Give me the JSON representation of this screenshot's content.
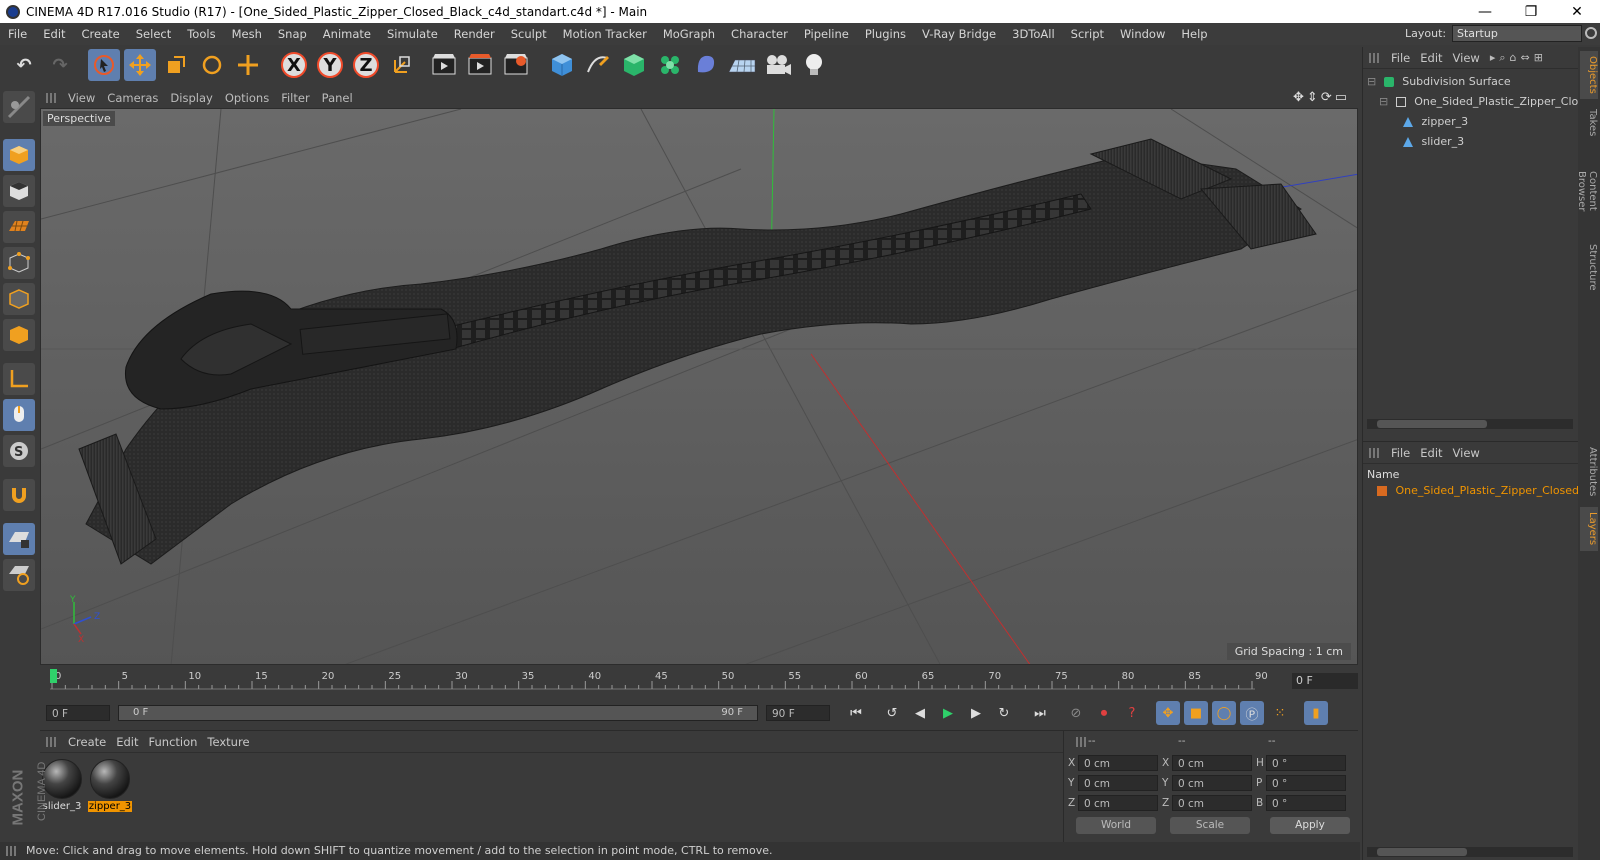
{
  "window": {
    "title": "CINEMA 4D R17.016 Studio (R17) - [One_Sided_Plastic_Zipper_Closed_Black_c4d_standart.c4d *] - Main",
    "minimize": "—",
    "maximize": "❐",
    "close": "✕"
  },
  "menubar": {
    "items": [
      "File",
      "Edit",
      "Create",
      "Select",
      "Tools",
      "Mesh",
      "Snap",
      "Animate",
      "Simulate",
      "Render",
      "Sculpt",
      "Motion Tracker",
      "MoGraph",
      "Character",
      "Pipeline",
      "Plugins",
      "V-Ray Bridge",
      "3DToAll",
      "Script",
      "Window",
      "Help"
    ],
    "layout_label": "Layout:",
    "layout_value": "Startup"
  },
  "toolbar": {
    "icons": [
      "undo-icon",
      "redo-icon",
      "live-selection-icon",
      "move-icon",
      "scale-icon",
      "rotate-icon",
      "last-tool-icon",
      "x-axis-icon",
      "y-axis-icon",
      "z-axis-icon",
      "coordinate-system-icon",
      "render-view-icon",
      "render-picture-viewer-icon",
      "edit-render-settings-icon",
      "cube-icon",
      "pen-spline-icon",
      "subdivision-icon",
      "cloner-icon",
      "deformer-icon",
      "floor-icon",
      "camera-icon",
      "light-icon"
    ],
    "x_label": "X",
    "y_label": "Y",
    "z_label": "Z"
  },
  "viewport": {
    "menu": [
      "View",
      "Cameras",
      "Display",
      "Options",
      "Filter",
      "Panel"
    ],
    "camera_label": "Perspective",
    "grid_spacing": "Grid Spacing : 1 cm",
    "axis_labels": {
      "y": "Y",
      "z": "Z",
      "x": "X"
    }
  },
  "timeline": {
    "ticks": [
      "0",
      "5",
      "10",
      "15",
      "20",
      "25",
      "30",
      "35",
      "40",
      "45",
      "50",
      "55",
      "60",
      "65",
      "70",
      "75",
      "80",
      "85",
      "90"
    ],
    "current_frame": "0 F",
    "start_field": "0 F",
    "range_start": "0 F",
    "range_end": "90 F",
    "end_field": "90 F"
  },
  "material_panel": {
    "menu": [
      "Create",
      "Edit",
      "Function",
      "Texture"
    ],
    "materials": [
      {
        "name": "slider_3",
        "selected": false
      },
      {
        "name": "zipper_3",
        "selected": true
      }
    ]
  },
  "coords": {
    "headers": [
      "--",
      "--",
      "--"
    ],
    "rows": [
      {
        "a": "X",
        "av": "0 cm",
        "b": "X",
        "bv": "0 cm",
        "c": "H",
        "cv": "0 °"
      },
      {
        "a": "Y",
        "av": "0 cm",
        "b": "Y",
        "bv": "0 cm",
        "c": "P",
        "cv": "0 °"
      },
      {
        "a": "Z",
        "av": "0 cm",
        "b": "Z",
        "bv": "0 cm",
        "c": "B",
        "cv": "0 °"
      }
    ],
    "world": "World",
    "scale": "Scale",
    "apply": "Apply"
  },
  "brand": {
    "line1": "MAXON",
    "line2": "CINEMA 4D"
  },
  "status": "Move: Click and drag to move elements. Hold down SHIFT to quantize movement / add to the selection in point mode, CTRL to remove.",
  "objects_panel": {
    "menu": [
      "File",
      "Edit",
      "View"
    ],
    "tree": [
      {
        "name": "Subdivision Surface",
        "level": 0
      },
      {
        "name": "One_Sided_Plastic_Zipper_Closed",
        "level": 1
      },
      {
        "name": "zipper_3",
        "level": 2
      },
      {
        "name": "slider_3",
        "level": 2
      }
    ]
  },
  "layers_panel": {
    "menu": [
      "File",
      "Edit",
      "View"
    ],
    "name_header": "Name",
    "row": "One_Sided_Plastic_Zipper_Closed"
  },
  "side_tabs": [
    "Objects",
    "Takes",
    "Content Browser",
    "Structure",
    "Attributes",
    "Layers"
  ],
  "colors": {
    "accent": "#f09400",
    "active_button": "#5f7faf",
    "viewport_bg": "#5a5a5a"
  }
}
